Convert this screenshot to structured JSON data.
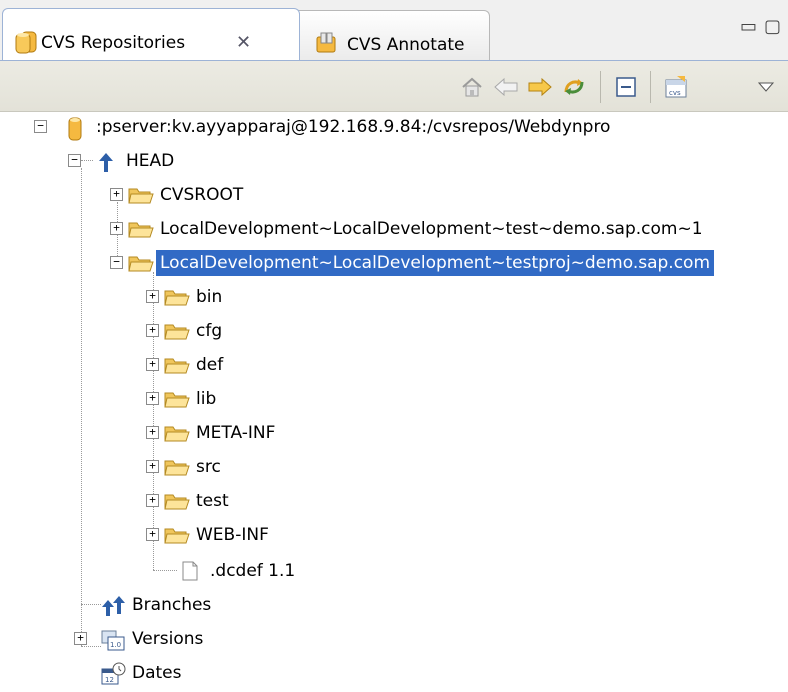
{
  "tabs": {
    "active": {
      "label": "CVS Repositories",
      "icon": "repository-icon",
      "close_icon": "close-icon"
    },
    "inactive": {
      "label": "CVS Annotate",
      "icon": "annotate-icon"
    },
    "window_controls": [
      "minimize-icon",
      "maximize-icon"
    ]
  },
  "toolbar": {
    "buttons": [
      "home-icon",
      "back-icon",
      "forward-icon",
      "refresh-icon",
      "collapse-all-icon",
      "new-repository-icon",
      "view-menu-icon"
    ]
  },
  "tree": {
    "repository": ":pserver:kv.ayyapparaj@192.168.9.84:/cvsrepos/Webdynpro",
    "head": "HEAD",
    "head_children": [
      "CVSROOT",
      "LocalDevelopment~LocalDevelopment~test~demo.sap.com~1",
      "LocalDevelopment~LocalDevelopment~testproj~demo.sap.com"
    ],
    "project_children": [
      "bin",
      "cfg",
      "def",
      "lib",
      "META-INF",
      "src",
      "test",
      "WEB-INF"
    ],
    "project_file": ".dcdef 1.1",
    "branches": "Branches",
    "versions": "Versions",
    "dates": "Dates"
  },
  "colors": {
    "selection": "#316ac5",
    "folder": "#f5c85b",
    "accent_orange": "#f5a623"
  }
}
